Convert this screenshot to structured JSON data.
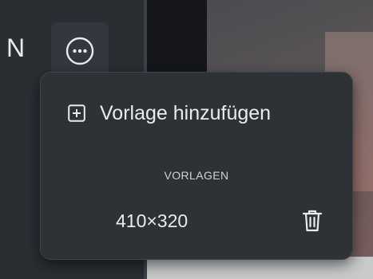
{
  "panel": {
    "label_partial": "N"
  },
  "menu": {
    "more_button_icon": "more-horizontal-circle-icon",
    "add_template": {
      "icon": "plus-square-icon",
      "label": "Vorlage hinzufügen"
    },
    "section_header": "VORLAGEN",
    "templates": [
      {
        "label": "410×320",
        "action_icon": "trash-icon"
      }
    ]
  },
  "colors": {
    "popup_background": "#2e3237",
    "text": "#e9ebee",
    "panel_background": "#2a2e33"
  }
}
